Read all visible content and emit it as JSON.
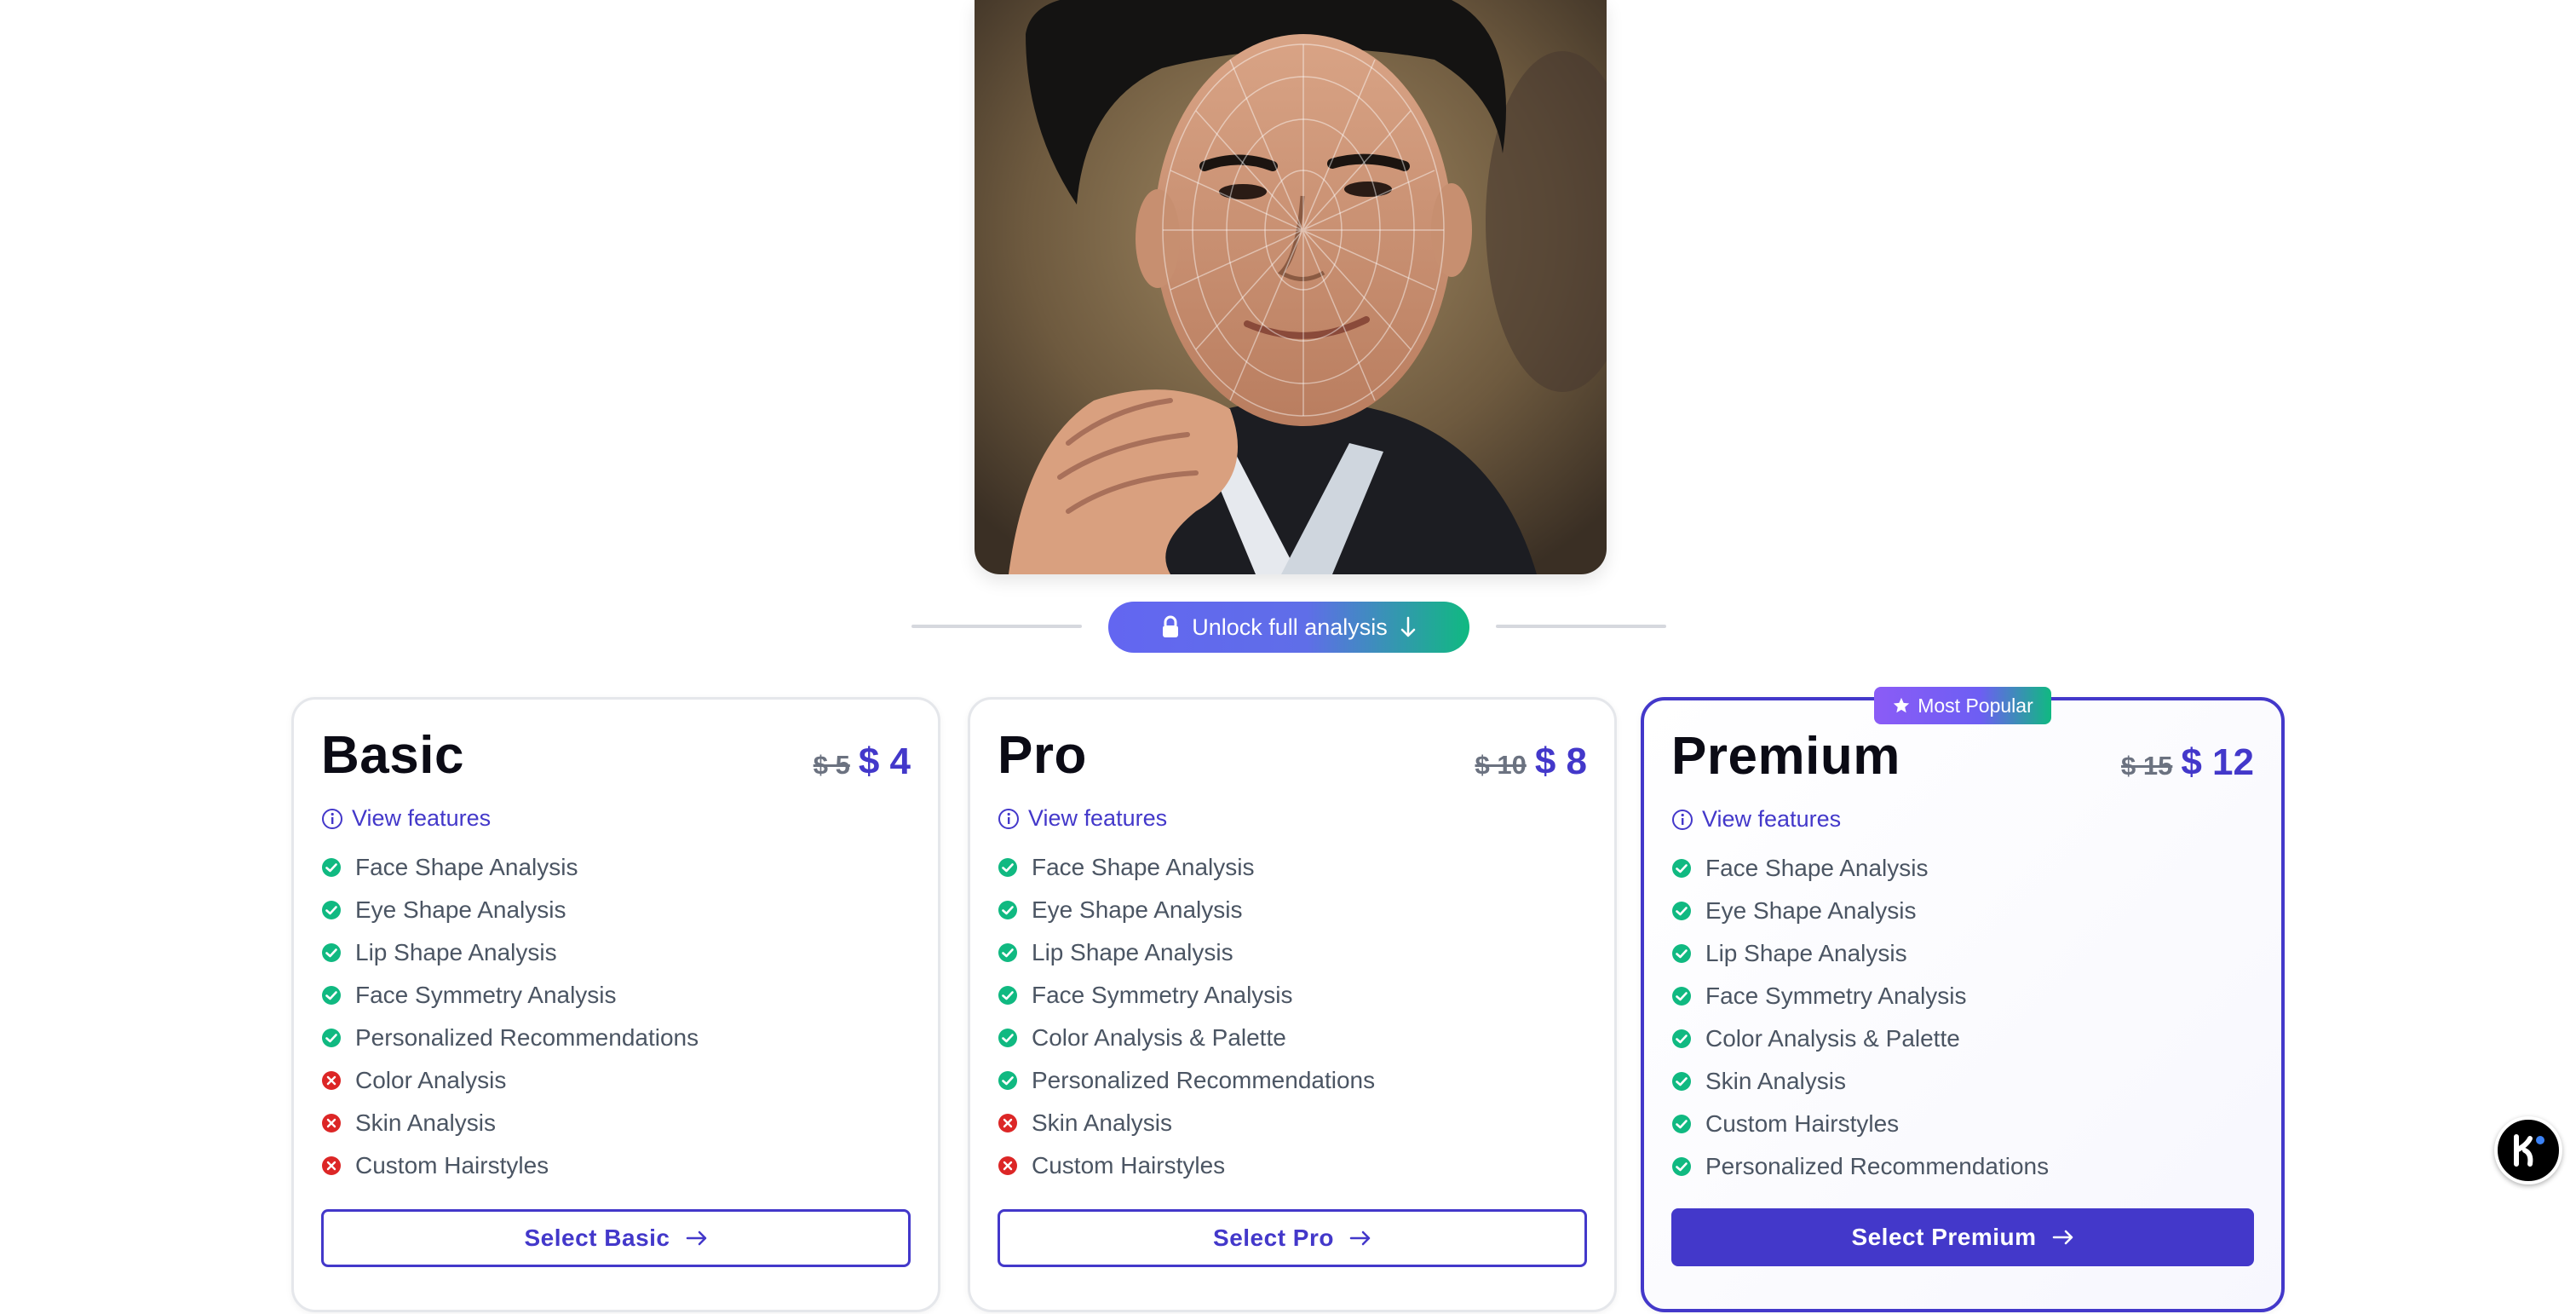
{
  "unlock": {
    "label": "Unlock full analysis"
  },
  "badge": {
    "label": "Most Popular"
  },
  "colors": {
    "accent": "#4338ca",
    "check": "#10b981",
    "cross": "#dc2626"
  },
  "plans": [
    {
      "name": "Basic",
      "old_price": "$ 5",
      "new_price": "$ 4",
      "view_features": "View features",
      "features": [
        {
          "text": "Face Shape Analysis",
          "included": true
        },
        {
          "text": "Eye Shape Analysis",
          "included": true
        },
        {
          "text": "Lip Shape Analysis",
          "included": true
        },
        {
          "text": "Face Symmetry Analysis",
          "included": true
        },
        {
          "text": "Personalized Recommendations",
          "included": true
        },
        {
          "text": "Color Analysis",
          "included": false
        },
        {
          "text": "Skin Analysis",
          "included": false
        },
        {
          "text": "Custom Hairstyles",
          "included": false
        }
      ],
      "cta": "Select Basic"
    },
    {
      "name": "Pro",
      "old_price": "$ 10",
      "new_price": "$ 8",
      "view_features": "View features",
      "features": [
        {
          "text": "Face Shape Analysis",
          "included": true
        },
        {
          "text": "Eye Shape Analysis",
          "included": true
        },
        {
          "text": "Lip Shape Analysis",
          "included": true
        },
        {
          "text": "Face Symmetry Analysis",
          "included": true
        },
        {
          "text": "Color Analysis & Palette",
          "included": true
        },
        {
          "text": "Personalized Recommendations",
          "included": true
        },
        {
          "text": "Skin Analysis",
          "included": false
        },
        {
          "text": "Custom Hairstyles",
          "included": false
        }
      ],
      "cta": "Select Pro"
    },
    {
      "name": "Premium",
      "old_price": "$ 15",
      "new_price": "$ 12",
      "view_features": "View features",
      "features": [
        {
          "text": "Face Shape Analysis",
          "included": true
        },
        {
          "text": "Eye Shape Analysis",
          "included": true
        },
        {
          "text": "Lip Shape Analysis",
          "included": true
        },
        {
          "text": "Face Symmetry Analysis",
          "included": true
        },
        {
          "text": "Color Analysis & Palette",
          "included": true
        },
        {
          "text": "Skin Analysis",
          "included": true
        },
        {
          "text": "Custom Hairstyles",
          "included": true
        },
        {
          "text": "Personalized Recommendations",
          "included": true
        }
      ],
      "cta": "Select Premium"
    }
  ]
}
